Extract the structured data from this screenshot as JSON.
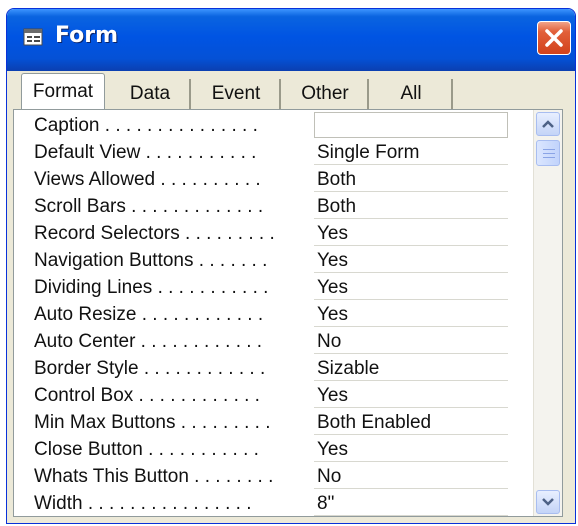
{
  "window": {
    "title": "Form"
  },
  "tabs": [
    {
      "label": "Format",
      "active": true
    },
    {
      "label": "Data",
      "active": false
    },
    {
      "label": "Event",
      "active": false
    },
    {
      "label": "Other",
      "active": false
    },
    {
      "label": "All",
      "active": false
    }
  ],
  "properties": [
    {
      "label": "Caption . . . . . . . . . . . . . . .",
      "value": ""
    },
    {
      "label": "Default View . . . . . . . . . . .",
      "value": "Single Form"
    },
    {
      "label": "Views Allowed . . . . . . . . . .",
      "value": "Both"
    },
    {
      "label": "Scroll Bars . . . . . . . . . . . . .",
      "value": "Both"
    },
    {
      "label": "Record Selectors . . . . . . . . .",
      "value": "Yes"
    },
    {
      "label": "Navigation Buttons . . . . . . .",
      "value": "Yes"
    },
    {
      "label": "Dividing Lines . . . . . . . . . . .",
      "value": "Yes"
    },
    {
      "label": "Auto Resize . . . . . . . . . . . .",
      "value": "Yes"
    },
    {
      "label": "Auto Center . . . . . . . . . . . .",
      "value": "No"
    },
    {
      "label": "Border Style . . . . . . . . . . . .",
      "value": "Sizable"
    },
    {
      "label": "Control Box . . . . . . . . . . . .",
      "value": "Yes"
    },
    {
      "label": "Min Max Buttons . . . . . . . . .",
      "value": "Both Enabled"
    },
    {
      "label": "Close Button . . . . . . . . . . .",
      "value": "Yes"
    },
    {
      "label": "Whats This Button . . . . . . . .",
      "value": "No"
    },
    {
      "label": "Width . . . . . . . . . . . . . . . .",
      "value": "8\""
    }
  ],
  "icons": {
    "title": "form-icon",
    "close": "close-icon",
    "scroll_up": "chevron-up-icon",
    "scroll_down": "chevron-down-icon"
  },
  "colors": {
    "titlebar": "#0054e3",
    "close_button": "#d2421c",
    "window_face": "#ece9d8"
  }
}
